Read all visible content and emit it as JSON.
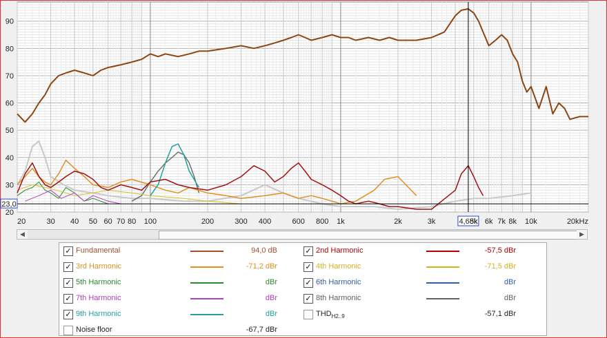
{
  "chart_data": {
    "type": "line",
    "xscale": "log",
    "xlim": [
      20,
      20000
    ],
    "ylim": [
      20,
      97
    ],
    "yticks": [
      20,
      30,
      40,
      50,
      60,
      70,
      80,
      90
    ],
    "xticks": [
      {
        "v": 20,
        "label": "20"
      },
      {
        "v": 30,
        "label": "30"
      },
      {
        "v": 40,
        "label": "40"
      },
      {
        "v": 50,
        "label": "50"
      },
      {
        "v": 60,
        "label": "60"
      },
      {
        "v": 70,
        "label": "70"
      },
      {
        "v": 80,
        "label": "80"
      },
      {
        "v": 100,
        "label": "100"
      },
      {
        "v": 200,
        "label": "200"
      },
      {
        "v": 300,
        "label": "300"
      },
      {
        "v": 400,
        "label": "400"
      },
      {
        "v": 600,
        "label": "600"
      },
      {
        "v": 800,
        "label": "800"
      },
      {
        "v": 1000,
        "label": "1k"
      },
      {
        "v": 2000,
        "label": "2k"
      },
      {
        "v": 3000,
        "label": "3k"
      },
      {
        "v": 5000,
        "label": "5k"
      },
      {
        "v": 6000,
        "label": "6k"
      },
      {
        "v": 7000,
        "label": "7k"
      },
      {
        "v": 8000,
        "label": "8k"
      },
      {
        "v": 10000,
        "label": "10k"
      },
      {
        "v": 20000,
        "label": "20kHz"
      }
    ],
    "cursor": {
      "x": 4680,
      "x_label": "4,68k",
      "y": 23.0,
      "y_label": "23,0"
    },
    "series": [
      {
        "name": "Fundamental",
        "color": "#8b4513",
        "width": 2,
        "x": [
          20,
          22,
          24,
          26,
          28,
          30,
          33,
          36,
          40,
          45,
          50,
          55,
          60,
          70,
          80,
          90,
          100,
          110,
          120,
          140,
          160,
          180,
          200,
          250,
          300,
          350,
          400,
          450,
          500,
          550,
          600,
          650,
          700,
          800,
          900,
          1000,
          1100,
          1200,
          1400,
          1600,
          1800,
          2000,
          2500,
          3000,
          3500,
          4000,
          4300,
          4680,
          5000,
          5300,
          5600,
          6000,
          6500,
          7000,
          7500,
          8000,
          8500,
          9000,
          9500,
          10000,
          11000,
          12000,
          13000,
          14000,
          15000,
          16000,
          18000,
          20000
        ],
        "y": [
          56,
          53,
          56,
          60,
          63,
          67,
          70,
          71,
          72,
          71,
          70,
          72,
          73,
          74,
          75,
          76,
          78,
          77,
          78,
          77,
          78,
          79,
          79,
          80,
          81,
          80,
          81,
          82,
          83,
          84,
          85,
          84,
          83,
          84,
          85,
          84,
          84,
          83,
          84,
          83,
          84,
          83,
          83,
          84,
          86,
          92,
          94,
          94.5,
          93,
          90,
          86,
          81,
          83,
          85,
          83,
          78,
          75,
          68,
          64,
          66,
          58,
          66,
          56,
          60,
          58,
          54,
          55,
          55
        ]
      },
      {
        "name": "2nd Harmonic",
        "color": "#a01010",
        "width": 1.5,
        "x": [
          20,
          22,
          24,
          26,
          28,
          30,
          33,
          36,
          40,
          45,
          50,
          55,
          60,
          70,
          80,
          90,
          100,
          120,
          140,
          160,
          200,
          250,
          300,
          350,
          400,
          450,
          500,
          550,
          600,
          650,
          700,
          800,
          900,
          1000,
          1100,
          1200,
          1400,
          1600,
          1800,
          2000,
          2500,
          3000,
          4000,
          4300,
          4680,
          5000,
          5300,
          5600
        ],
        "y": [
          27,
          34,
          38,
          33,
          30,
          29,
          31,
          33,
          35,
          34,
          32,
          29,
          28,
          30,
          29,
          28,
          31,
          32,
          30,
          29,
          28,
          30,
          33,
          37,
          35,
          31,
          33,
          36,
          38,
          35,
          32,
          30,
          28,
          26,
          24,
          23,
          24,
          23,
          22,
          22,
          21,
          21,
          28,
          34,
          37,
          33,
          29,
          26
        ]
      },
      {
        "name": "3rd Harmonic",
        "color": "#e09020",
        "width": 1.5,
        "x": [
          20,
          22,
          24,
          26,
          28,
          30,
          33,
          36,
          40,
          45,
          50,
          60,
          70,
          80,
          100,
          120,
          140,
          160,
          200,
          250,
          300,
          400,
          500,
          600,
          700,
          800,
          900,
          1000,
          1200,
          1500,
          1700,
          2000,
          2200,
          2500
        ],
        "y": [
          30,
          33,
          36,
          33,
          31,
          30,
          34,
          39,
          36,
          33,
          30,
          29,
          31,
          32,
          30,
          28,
          27,
          29,
          27,
          26,
          25,
          26,
          27,
          25,
          26,
          25,
          24,
          23,
          24,
          28,
          32,
          33,
          30,
          26
        ]
      },
      {
        "name": "4th Harmonic",
        "color": "#d8c020",
        "width": 1,
        "x": [
          20,
          24,
          28,
          32,
          36,
          40,
          50,
          60,
          80,
          100,
          150,
          200,
          300
        ],
        "y": [
          28,
          30,
          29,
          28,
          27,
          26,
          27,
          28,
          27,
          26,
          25,
          24,
          23
        ]
      },
      {
        "name": "5th Harmonic",
        "color": "#2a8a2a",
        "width": 1,
        "x": [
          20,
          22,
          24,
          26,
          28,
          30,
          33,
          36,
          40,
          45,
          50,
          60
        ],
        "y": [
          26,
          28,
          29,
          31,
          28,
          27,
          25,
          29,
          27,
          24,
          25,
          23
        ]
      },
      {
        "name": "7th Harmonic",
        "color": "#b040c0",
        "width": 1,
        "x": [
          22,
          26,
          30,
          34,
          40,
          45,
          50,
          60,
          70
        ],
        "y": [
          24,
          26,
          28,
          25,
          27,
          24,
          26,
          24,
          23
        ]
      },
      {
        "name": "8th Harmonic",
        "color": "#707070",
        "width": 1.5,
        "x": [
          80,
          90,
          100,
          110,
          120,
          130,
          140,
          150,
          160,
          170,
          180
        ],
        "y": [
          24,
          26,
          31,
          35,
          38,
          40,
          42,
          41,
          38,
          33,
          27
        ]
      },
      {
        "name": "9th Harmonic",
        "color": "#20a0a0",
        "width": 1.5,
        "x": [
          100,
          110,
          120,
          130,
          140,
          150,
          160,
          180
        ],
        "y": [
          26,
          30,
          38,
          44,
          45,
          41,
          35,
          29
        ]
      },
      {
        "name": "Noise floor",
        "color": "#c8c8c8",
        "width": 2,
        "x": [
          20,
          22,
          24,
          26,
          28,
          30,
          35,
          40,
          50,
          60,
          80,
          100,
          150,
          200,
          300,
          400,
          500,
          600,
          800,
          1000,
          1500,
          2000,
          3000,
          4000,
          5000,
          6000,
          8000,
          10000
        ],
        "y": [
          30,
          35,
          44,
          46,
          40,
          33,
          30,
          28,
          27,
          26,
          25,
          25,
          24,
          24,
          26,
          30,
          27,
          25,
          23,
          22,
          22,
          21,
          22,
          24,
          25,
          25,
          26,
          27
        ]
      }
    ]
  },
  "legend": {
    "items": [
      {
        "label": "Fundamental",
        "value": "94,0 dB",
        "color": "#a0522d",
        "checked": true
      },
      {
        "label": "2nd Harmonic",
        "value": "-57,5 dBr",
        "color": "#b00000",
        "checked": true
      },
      {
        "label": "3rd Harmonic",
        "value": "-71,2 dBr",
        "color": "#e09020",
        "checked": true
      },
      {
        "label": "4th Harmonic",
        "value": "-71,5 dBr",
        "color": "#d8b020",
        "checked": true
      },
      {
        "label": "5th Harmonic",
        "value": "dBr",
        "color": "#2a8a2a",
        "checked": true
      },
      {
        "label": "6th Harmonic",
        "value": "dBr",
        "color": "#3060a0",
        "checked": true
      },
      {
        "label": "7th Harmonic",
        "value": "dBr",
        "color": "#b040c0",
        "checked": true
      },
      {
        "label": "8th Harmonic",
        "value": "dBr",
        "color": "#606060",
        "checked": true
      },
      {
        "label": "9th Harmonic",
        "value": "dBr",
        "color": "#20a0a0",
        "checked": true
      },
      {
        "label": "THD",
        "sub": "H2..9",
        "value": "-57,1 dBr",
        "color": "#222222",
        "checked": false
      },
      {
        "label": "Noise floor",
        "value": "-67,7 dBr",
        "color": "#222222",
        "checked": false
      }
    ]
  },
  "checkmark": "✓",
  "scrollbar": {
    "left_arrow": "◀",
    "right_arrow": "▶"
  }
}
